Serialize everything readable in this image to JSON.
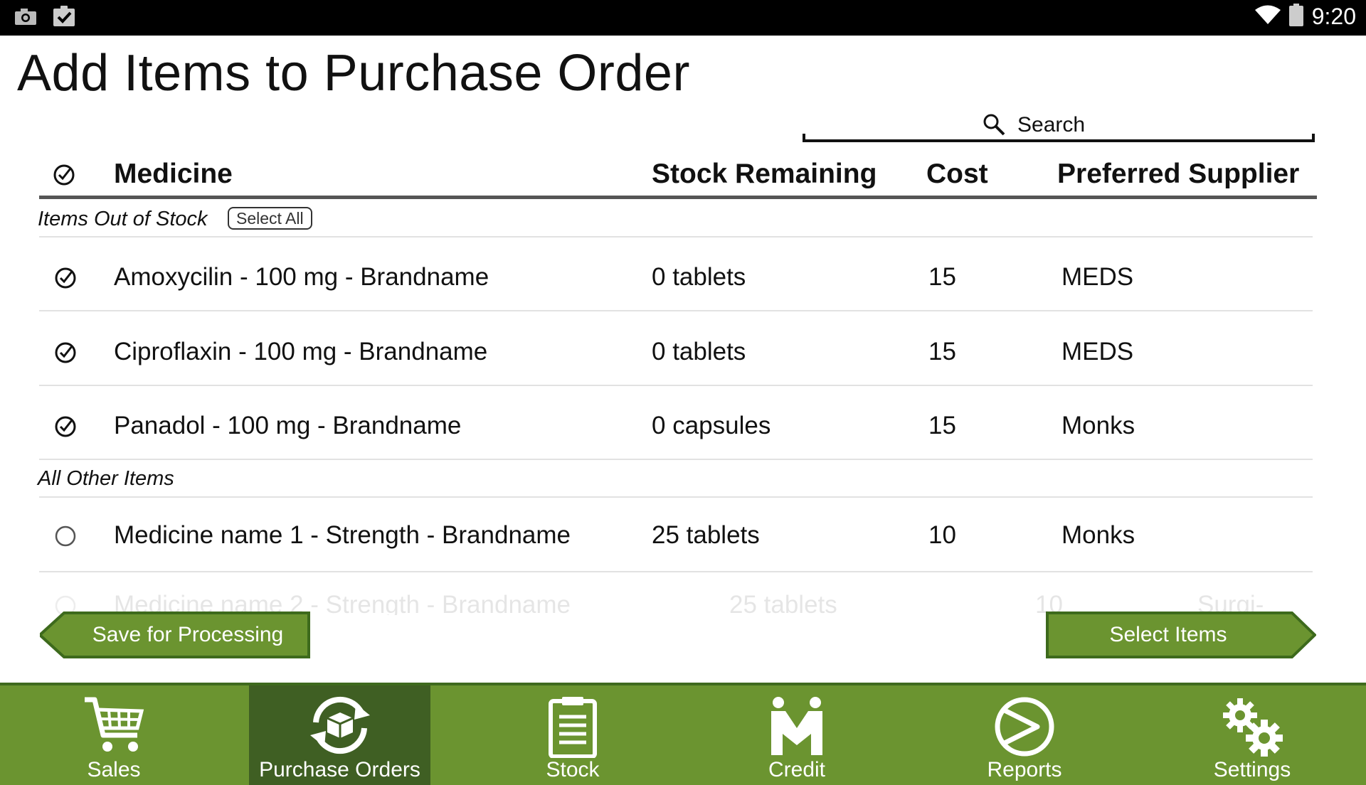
{
  "status_bar": {
    "time": "9:20",
    "icons": [
      "camera-icon",
      "clipboard-check-icon",
      "wifi-icon",
      "battery-icon"
    ]
  },
  "page": {
    "title": "Add Items to Purchase Order"
  },
  "search": {
    "placeholder": "Search",
    "icon": "search-icon"
  },
  "table": {
    "columns": [
      "Medicine",
      "Stock Remaining",
      "Cost",
      "Preferred Supplier"
    ],
    "sections": [
      {
        "label": "Items Out of Stock",
        "action_label": "Select All",
        "rows": [
          {
            "selected": true,
            "medicine": "Amoxycilin - 100 mg - Brandname",
            "stock": "0 tablets",
            "cost": "15",
            "supplier": "MEDS"
          },
          {
            "selected": true,
            "medicine": "Ciproflaxin - 100 mg - Brandname",
            "stock": "0 tablets",
            "cost": "15",
            "supplier": "MEDS"
          },
          {
            "selected": true,
            "medicine": "Panadol - 100 mg - Brandname",
            "stock": "0 capsules",
            "cost": "15",
            "supplier": "Monks"
          }
        ]
      },
      {
        "label": "All Other Items",
        "rows": [
          {
            "selected": false,
            "medicine": "Medicine name 1 - Strength - Brandname",
            "stock": "25 tablets",
            "cost": "10",
            "supplier": "Monks"
          },
          {
            "selected": false,
            "medicine": "Medicine name 2 - Strength - Brandname",
            "stock": "25 tablets",
            "cost": "10",
            "supplier": "Surgi-"
          }
        ]
      }
    ]
  },
  "actions": {
    "save_label": "Save for Processing",
    "select_label": "Select Items"
  },
  "colors": {
    "accent_green": "#6b9430",
    "active_nav": "#3f5f23",
    "button_green": "#6b9430",
    "button_border": "#3d6a1c"
  },
  "nav": {
    "items": [
      {
        "label": "Sales",
        "icon": "cart-icon",
        "active": false
      },
      {
        "label": "Purchase Orders",
        "icon": "purchase-orders-icon",
        "active": true
      },
      {
        "label": "Stock",
        "icon": "clipboard-icon",
        "active": false
      },
      {
        "label": "Credit",
        "icon": "credit-handshake-icon",
        "active": false
      },
      {
        "label": "Reports",
        "icon": "reports-icon",
        "active": false
      },
      {
        "label": "Settings",
        "icon": "gears-icon",
        "active": false
      }
    ]
  }
}
